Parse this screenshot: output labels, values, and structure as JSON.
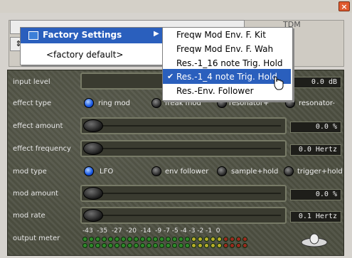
{
  "window": {
    "close_glyph": "×"
  },
  "host": {
    "field_small_glyph": "⇕",
    "faint_text": "TDM"
  },
  "menu": {
    "factory_settings_label": "Factory Settings",
    "factory_default_label": "<factory default>",
    "submenu_arrow": "▶",
    "presets": [
      {
        "label": "Freqw Mod Env. F. Kit",
        "checked": false
      },
      {
        "label": "Freqw Mod Env. F. Wah",
        "checked": false
      },
      {
        "label": "Res.-1_16 note Trig. Hold",
        "checked": false
      },
      {
        "label": "Res.-1_4 note Trig. Hold",
        "checked": true
      },
      {
        "label": "Res.-Env. Follower",
        "checked": false
      }
    ],
    "check_glyph": "✔"
  },
  "plugin": {
    "input_level": {
      "label": "input level",
      "value": "0.0 dB"
    },
    "effect_type": {
      "label": "effect type",
      "options": [
        "ring mod",
        "freak mod",
        "resonator+",
        "resonator-"
      ],
      "selected": "ring mod"
    },
    "effect_amount": {
      "label": "effect amount",
      "value": "0.0 %"
    },
    "effect_frequency": {
      "label": "effect frequency",
      "value": "0.0 Hertz"
    },
    "mod_type": {
      "label": "mod type",
      "options": [
        "LFO",
        "env follower",
        "sample+hold",
        "trigger+hold"
      ],
      "selected": "LFO"
    },
    "mod_amount": {
      "label": "mod amount",
      "value": "0.0 %"
    },
    "mod_rate": {
      "label": "mod rate",
      "value": "0.1 Hertz"
    },
    "output_meter": {
      "label": "output meter",
      "scale": "-43  -35  -27  -20  -14  -9 -7 -5 -4 -3 -2 -1  0"
    }
  },
  "colors": {
    "menu_highlight": "#2a5fbd",
    "radio_selected": "#1555e0",
    "close_button": "#e05a2e"
  }
}
